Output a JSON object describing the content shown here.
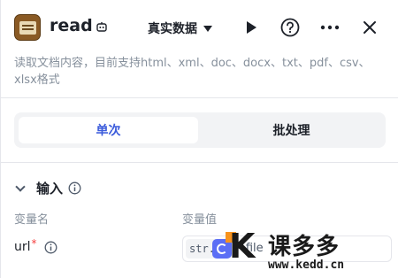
{
  "header": {
    "title": "read",
    "data_mode": "真实数据",
    "icons": [
      "book-icon",
      "bot-icon",
      "caret-down-icon",
      "play-icon",
      "help-icon",
      "more-icon",
      "close-icon"
    ]
  },
  "description": "读取文档内容，目前支持html、xml、doc、docx、txt、pdf、csv、xlsx格式",
  "tabs": [
    {
      "label": "单次",
      "active": true
    },
    {
      "label": "批处理",
      "active": false
    }
  ],
  "input_section": {
    "title": "输入",
    "col_name": "变量名",
    "col_value": "变量值",
    "params": [
      {
        "name": "url",
        "required_mark": "*",
        "type_tag": "str.",
        "value": "- file"
      }
    ]
  },
  "watermark": {
    "brand": "课多多",
    "url": "www.kedd.cn"
  },
  "colors": {
    "accent": "#3b5bdb",
    "required": "#f53f3f",
    "muted_text": "#86909c",
    "ref_chip": "#5b6ef5"
  }
}
